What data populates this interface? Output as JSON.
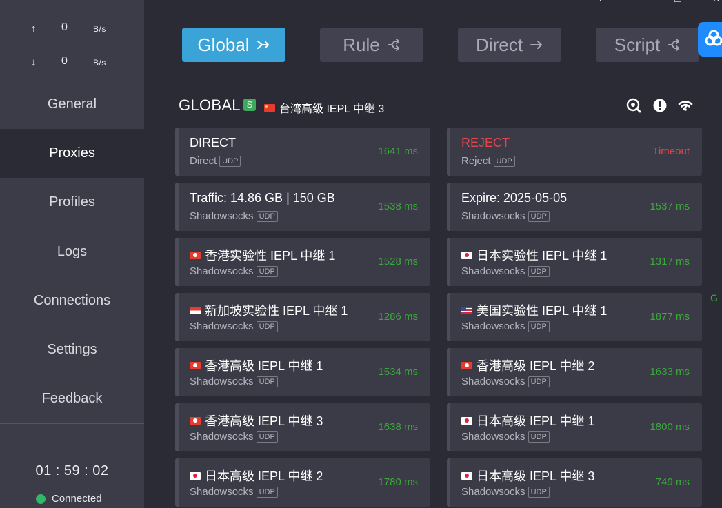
{
  "traffic": {
    "up": {
      "arrow": "↑",
      "value": "0",
      "unit": "B/s"
    },
    "down": {
      "arrow": "↓",
      "value": "0",
      "unit": "B/s"
    }
  },
  "nav": {
    "items": [
      {
        "label": "General"
      },
      {
        "label": "Proxies",
        "active": true
      },
      {
        "label": "Profiles"
      },
      {
        "label": "Logs"
      },
      {
        "label": "Connections"
      },
      {
        "label": "Settings"
      },
      {
        "label": "Feedback"
      }
    ]
  },
  "status": {
    "timer": "01 : 59 : 02",
    "connection": "Connected",
    "connection_color": "#2fb86a"
  },
  "modes": [
    {
      "label": "Global",
      "icon": "merge-arrow-icon",
      "active": true
    },
    {
      "label": "Rule",
      "icon": "shuffle-icon"
    },
    {
      "label": "Direct",
      "icon": "arrow-right-icon"
    },
    {
      "label": "Script",
      "icon": "shuffle-icon"
    }
  ],
  "group": {
    "title": "GLOBAL",
    "badge": "S",
    "selected": "台湾高级 IEPL 中继 3",
    "selected_flag": "cn"
  },
  "proxies": [
    {
      "name": "DIRECT",
      "type": "Direct",
      "udp": "UDP",
      "delay": "1641 ms"
    },
    {
      "name": "REJECT",
      "type": "Reject",
      "udp": "UDP",
      "delay": "Timeout",
      "reject": true
    },
    {
      "name": "Traffic: 14.86 GB | 150 GB",
      "type": "Shadowsocks",
      "udp": "UDP",
      "delay": "1538 ms"
    },
    {
      "name": "Expire: 2025-05-05",
      "type": "Shadowsocks",
      "udp": "UDP",
      "delay": "1537 ms"
    },
    {
      "name": "香港实验性 IEPL 中继 1",
      "flag": "hk",
      "type": "Shadowsocks",
      "udp": "UDP",
      "delay": "1528 ms"
    },
    {
      "name": "日本实验性 IEPL 中继 1",
      "flag": "jp",
      "type": "Shadowsocks",
      "udp": "UDP",
      "delay": "1317 ms"
    },
    {
      "name": "新加坡实验性 IEPL 中继 1",
      "flag": "sg",
      "type": "Shadowsocks",
      "udp": "UDP",
      "delay": "1286 ms"
    },
    {
      "name": "美国实验性 IEPL 中继 1",
      "flag": "us",
      "type": "Shadowsocks",
      "udp": "UDP",
      "delay": "1877 ms"
    },
    {
      "name": "香港高级 IEPL 中继 1",
      "flag": "hk",
      "type": "Shadowsocks",
      "udp": "UDP",
      "delay": "1534 ms"
    },
    {
      "name": "香港高级 IEPL 中继 2",
      "flag": "hk",
      "type": "Shadowsocks",
      "udp": "UDP",
      "delay": "1633 ms"
    },
    {
      "name": "香港高级 IEPL 中继 3",
      "flag": "hk",
      "type": "Shadowsocks",
      "udp": "UDP",
      "delay": "1638 ms"
    },
    {
      "name": "日本高级 IEPL 中继 1",
      "flag": "jp",
      "type": "Shadowsocks",
      "udp": "UDP",
      "delay": "1800 ms"
    },
    {
      "name": "日本高级 IEPL 中继 2",
      "flag": "jp",
      "type": "Shadowsocks",
      "udp": "UDP",
      "delay": "1780 ms"
    },
    {
      "name": "日本高级 IEPL 中继 3",
      "flag": "jp",
      "type": "Shadowsocks",
      "udp": "UDP",
      "delay": "749 ms"
    }
  ],
  "edge_text": "G",
  "colors": {
    "accent": "#3aa3d7",
    "delay_ok": "#3aa83a",
    "delay_bad": "#e0474c",
    "float_button": "#1e8bff"
  }
}
